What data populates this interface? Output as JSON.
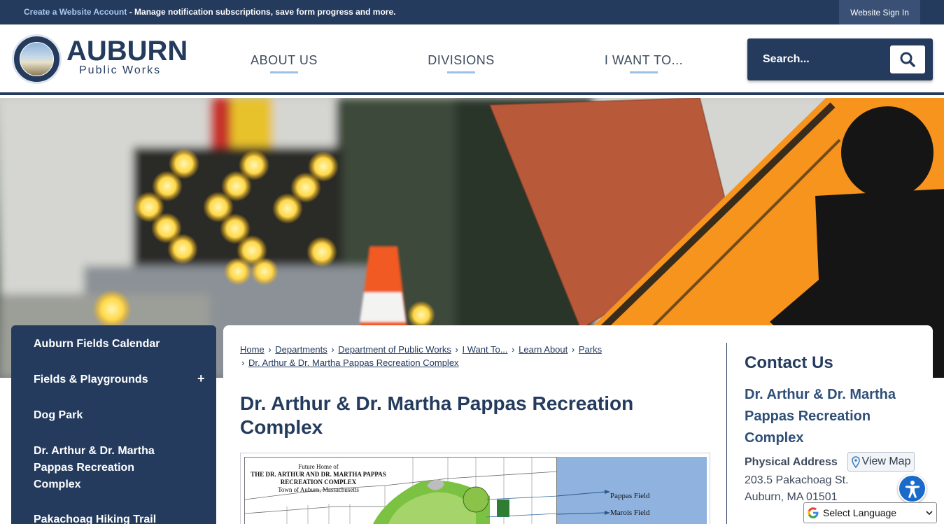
{
  "topbar": {
    "account_link": "Create a Website Account",
    "account_text": " - Manage notification subscriptions, save form progress and more.",
    "signin": "Website Sign In"
  },
  "header": {
    "logo_title": "AUBURN",
    "logo_subtitle": "Public Works",
    "nav": [
      "ABOUT US",
      "DIVISIONS",
      "I WANT TO..."
    ],
    "search_placeholder": "Search..."
  },
  "sidenav": {
    "items": [
      "Auburn Fields Calendar",
      "Fields & Playgrounds",
      "Dog Park",
      "Dr. Arthur & Dr. Martha Pappas Recreation Complex",
      "Pakachoag Hiking Trail"
    ],
    "expand_symbol": "+"
  },
  "breadcrumbs": [
    "Home",
    "Departments",
    "Department of Public Works",
    "I Want To...",
    "Learn About",
    "Parks",
    "Dr. Arthur & Dr. Martha Pappas Recreation Complex"
  ],
  "breadcrumb_separator": "›",
  "page": {
    "title": "Dr. Arthur & Dr. Martha Pappas Recreation Complex",
    "map_image": {
      "line1": "Future Home of",
      "line2": "THE DR. ARTHUR AND DR. MARTHA PAPPAS",
      "line3": "RECREATION COMPLEX",
      "line4": "Town of Auburn, Massachusetts",
      "labels": [
        "Pappas Field",
        "Marois Field"
      ]
    }
  },
  "contact": {
    "heading": "Contact Us",
    "name": "Dr. Arthur & Dr. Martha Pappas Recreation Complex",
    "address_label": "Physical Address",
    "view_map": "View Map",
    "address_line1": "203.5 Pakachoag St.",
    "address_line2": "Auburn, MA 01501"
  },
  "language": {
    "label": "Select Language"
  },
  "colors": {
    "navy": "#243b5e",
    "accent": "#9cc1e8",
    "sign_orange": "#f7941d"
  }
}
